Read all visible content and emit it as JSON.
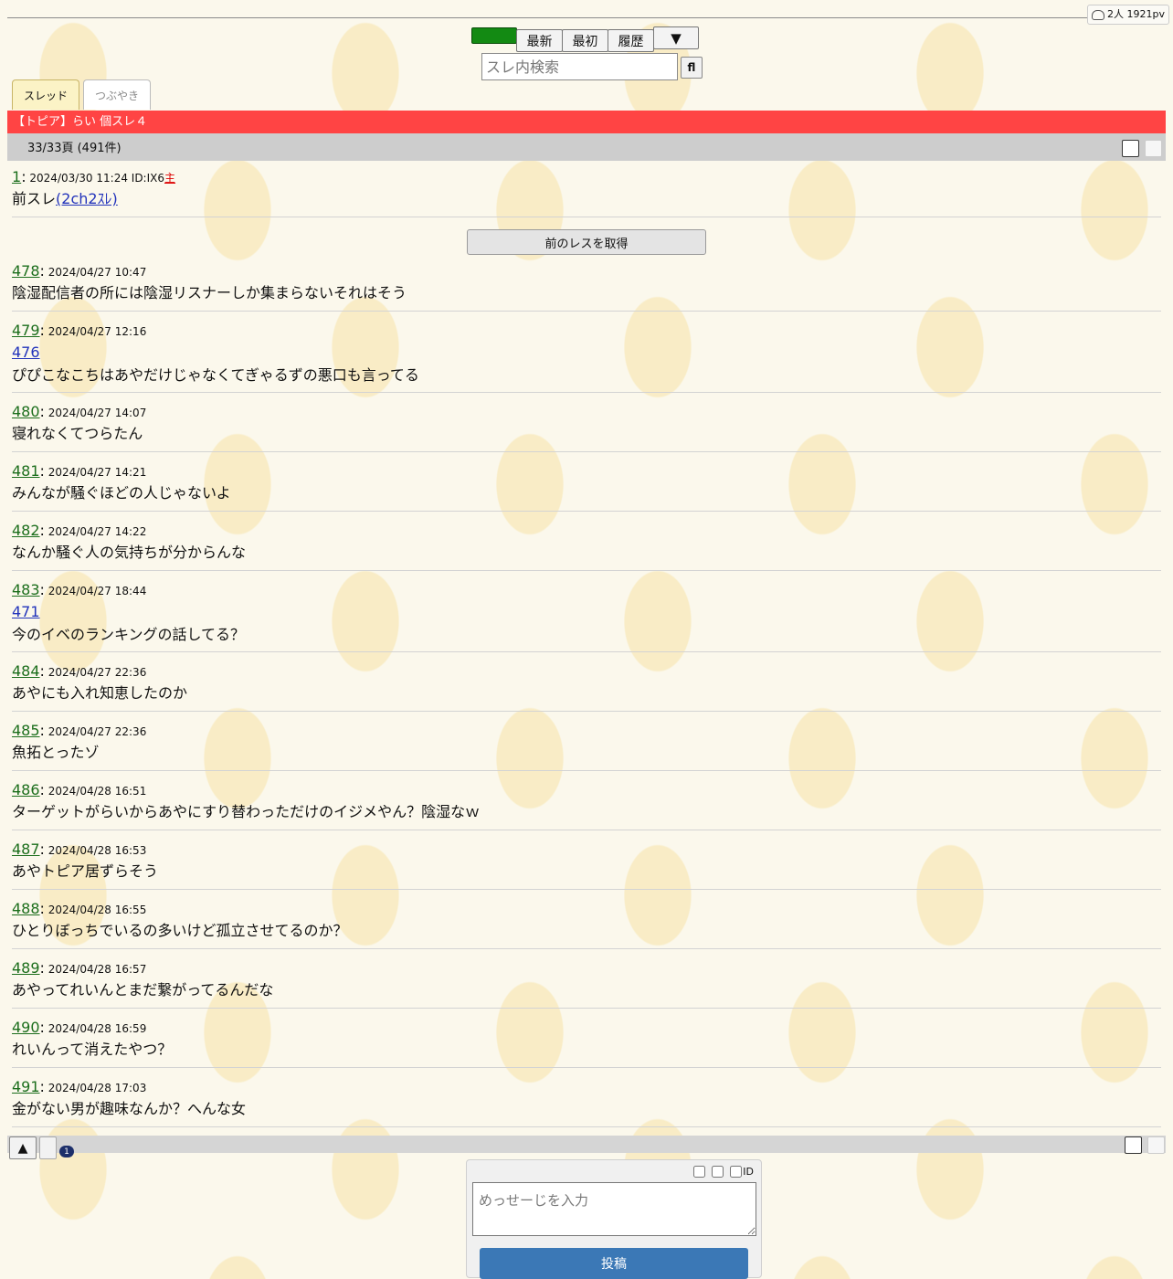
{
  "counter": {
    "text": "2人 1921pv"
  },
  "nav": {
    "green_label": "",
    "latest": "最新",
    "first": "最初",
    "history": "履歴",
    "menu": "▼"
  },
  "search": {
    "placeholder": "スレ内検索",
    "button": "fl"
  },
  "tabs": [
    {
      "label": "スレッド"
    },
    {
      "label": "つぶやき"
    }
  ],
  "thread": {
    "title": "【トピア】らい 個スレ４",
    "page_info": "33/33頁 (491件)"
  },
  "first_post": {
    "num": "1",
    "date": "2024/03/30 11:24 ID:IX6",
    "owner": "主",
    "body_prefix": "前スレ",
    "body_link": "(2ch2ｽﾚ)"
  },
  "prev_button": "前のレスを取得",
  "posts": [
    {
      "num": "478",
      "date": "2024/04/27 10:47",
      "anchor": "",
      "body": "陰湿配信者の所には陰湿リスナーしか集まらないそれはそう"
    },
    {
      "num": "479",
      "date": "2024/04/27 12:16",
      "anchor": "476",
      "body": "ぴぴこなこちはあやだけじゃなくてぎゃるずの悪口も言ってる"
    },
    {
      "num": "480",
      "date": "2024/04/27 14:07",
      "anchor": "",
      "body": "寝れなくてつらたん"
    },
    {
      "num": "481",
      "date": "2024/04/27 14:21",
      "anchor": "",
      "body": "みんなが騒ぐほどの人じゃないよ"
    },
    {
      "num": "482",
      "date": "2024/04/27 14:22",
      "anchor": "",
      "body": "なんか騒ぐ人の気持ちが分からんな"
    },
    {
      "num": "483",
      "date": "2024/04/27 18:44",
      "anchor": "471",
      "body": "今のイベのランキングの話してる？"
    },
    {
      "num": "484",
      "date": "2024/04/27 22:36",
      "anchor": "",
      "body": "あやにも入れ知恵したのか"
    },
    {
      "num": "485",
      "date": "2024/04/27 22:36",
      "anchor": "",
      "body": "魚拓とったゾ"
    },
    {
      "num": "486",
      "date": "2024/04/28 16:51",
      "anchor": "",
      "body": "ターゲットがらいからあやにすり替わっただけのイジメやん？陰湿なｗ"
    },
    {
      "num": "487",
      "date": "2024/04/28 16:53",
      "anchor": "",
      "body": "あやトピア居ずらそう"
    },
    {
      "num": "488",
      "date": "2024/04/28 16:55",
      "anchor": "",
      "body": "ひとりぼっちでいるの多いけど孤立させてるのか？"
    },
    {
      "num": "489",
      "date": "2024/04/28 16:57",
      "anchor": "",
      "body": "あやってれいんとまだ繋がってるんだな"
    },
    {
      "num": "490",
      "date": "2024/04/28 16:59",
      "anchor": "",
      "body": "れいんって消えたやつ？"
    },
    {
      "num": "491",
      "date": "2024/04/28 17:03",
      "anchor": "",
      "body": "金がない男が趣味なんか？へんな女"
    }
  ],
  "bottom": {
    "up": "▲",
    "badge": "1"
  },
  "form": {
    "checks": [
      {
        "label": ""
      },
      {
        "label": ""
      },
      {
        "label": "ID"
      }
    ],
    "placeholder": "めっせーじを入力",
    "submit": "投稿"
  }
}
